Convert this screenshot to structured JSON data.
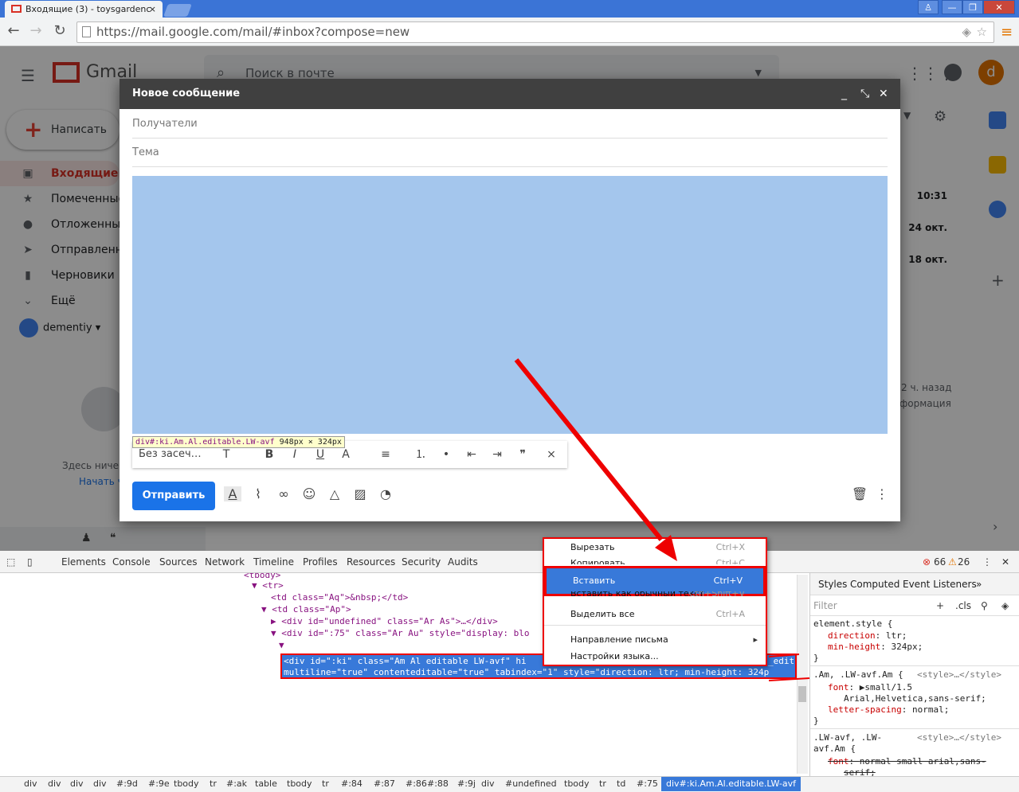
{
  "browser": {
    "tab_title": "Входящие (3) - toysgardenc",
    "tab_close": "×",
    "url_host": "https://mail.google.com",
    "url_path": "/mail/#inbox?compose=new",
    "win_user": "♙",
    "win_min": "—",
    "win_max": "❐",
    "win_close": "✕"
  },
  "gmail": {
    "logo_text": "Gmail",
    "search_placeholder": "Поиск в почте",
    "compose_label": "Написать",
    "nav": [
      {
        "label": "Входящие",
        "icon": "inbox-icon"
      },
      {
        "label": "Помеченные",
        "icon": "star-icon"
      },
      {
        "label": "Отложенные",
        "icon": "clock-icon"
      },
      {
        "label": "Отправленные",
        "icon": "send-icon"
      },
      {
        "label": "Черновики",
        "icon": "draft-icon"
      },
      {
        "label": "Ещё",
        "icon": "chevron-down-icon"
      }
    ],
    "user_name": "dementiy",
    "avatar_letter": "d",
    "mail_times": [
      "10:31",
      "24 окт.",
      "18 окт."
    ],
    "activity_1": "2 ч. назад",
    "activity_2": "формация",
    "hangouts_text": "Здесь ниче",
    "hangouts_link": "Начать ч"
  },
  "compose": {
    "title": "Новое сообщение",
    "recipients_placeholder": "Получатели",
    "subject_placeholder": "Тема",
    "font_label": "Без засеч…",
    "send_label": "Отправить",
    "tooltip_selector": "div#:ki.Am.Al.editable.LW-avf",
    "tooltip_size": "948px × 324px"
  },
  "devtools": {
    "tabs": [
      "Elements",
      "Console",
      "Sources",
      "Network",
      "Timeline",
      "Profiles",
      "Resources",
      "Security",
      "Audits"
    ],
    "errors": "66",
    "warnings": "26",
    "dom_lines": [
      "<tbody>",
      "<tr>",
      "<td class=\"Aq\">&nbsp;</td>",
      "<td class=\"Ap\">",
      "<div id=\"undefined\" class=\"Ar As\">…</div>",
      "<div id=\":75\" class=\"Ar Au\" style=\"display: blo"
    ],
    "selected_line_1": "<div id=\":ki\" class=\"Am Al editable LW-avf\" hi",
    "selected_line_1_tail": "_edit",
    "selected_line_2": "multiline=\"true\" contenteditable=\"true\" tabindex=\"1\" style=\"direction: ltr; min-height: 324p",
    "styles_tabs": [
      "Styles",
      "Computed",
      "Event Listeners"
    ],
    "filter_placeholder": "Filter",
    "filter_cls": ".cls",
    "rules": [
      {
        "selector": "element.style {",
        "src": "",
        "props": [
          [
            "direction",
            "ltr;"
          ],
          [
            "min-height",
            "324px;"
          ]
        ]
      },
      {
        "selector": ".Am, .LW-avf.Am {",
        "src": "<style>…</style>",
        "props": [
          [
            "font",
            "▶small/1.5"
          ],
          [
            "",
            "Arial,Helvetica,sans-serif;"
          ],
          [
            "letter-spacing",
            "normal;"
          ]
        ]
      },
      {
        "selector": ".LW-avf, .LW-",
        "src": "<style>…</style>",
        "props": [
          [
            "",
            "avf.Am {"
          ],
          [
            "font",
            "normal small arial,sans-"
          ],
          [
            "",
            "serif;"
          ]
        ]
      }
    ],
    "crumbs": [
      "div",
      "div",
      "div",
      "div",
      "#:9d",
      "#:9e",
      "tbody",
      "tr",
      "#:ak",
      "table",
      "tbody",
      "tr",
      "#:84",
      "#:87",
      "#:86",
      "#:88",
      "#:9j",
      "div",
      "#undefined",
      "tbody",
      "tr",
      "td",
      "#:75"
    ],
    "crumb_selected": "div#:ki.Am.Al.editable.LW-avf"
  },
  "context_menu": [
    {
      "label": "Вырезать",
      "shortcut": "Ctrl+X"
    },
    {
      "label": "Копировать",
      "shortcut": "Ctrl+C"
    },
    {
      "label": "Вставить",
      "shortcut": "Ctrl+V"
    },
    {
      "label": "Вставить как обычный текст",
      "shortcut": "Ctrl+Shift+V"
    },
    {
      "label": "Выделить все",
      "shortcut": "Ctrl+A"
    },
    {
      "label": "Направление письма",
      "shortcut": ""
    },
    {
      "label": "Настройки языка...",
      "shortcut": ""
    }
  ],
  "colors": {
    "highlight": "#a4c6ed",
    "accent": "#1a73e8",
    "annotation": "#ee0000"
  }
}
